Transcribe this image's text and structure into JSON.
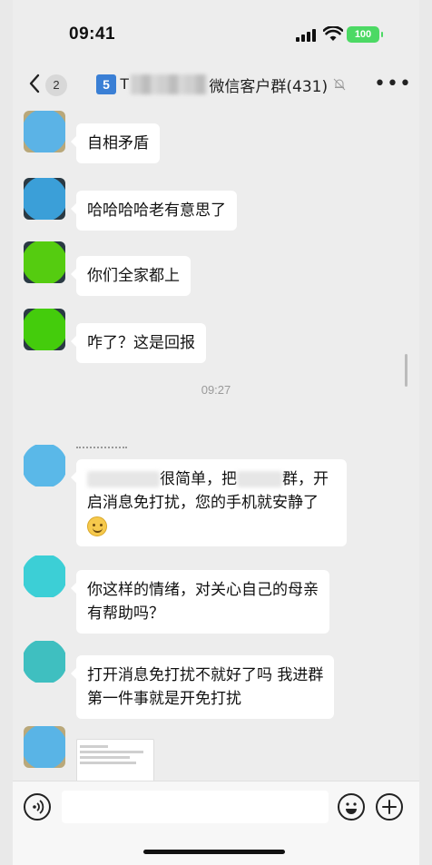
{
  "status_bar": {
    "time": "09:41",
    "battery": "100"
  },
  "nav": {
    "back_count": "2",
    "title_prefix_number": "5",
    "title_prefix_text": "T",
    "title_suffix": "微信客户群(431)"
  },
  "messages": [
    {
      "text": "自相矛盾"
    },
    {
      "text": "哈哈哈哈老有意思了"
    },
    {
      "text": "你们全家都上"
    },
    {
      "text": "咋了？这是回报"
    }
  ],
  "timestamp": "09:27",
  "long_message": {
    "part1": "很简单，把",
    "part2": "群，开",
    "line2": "启消息免打扰，您的手机就安静了"
  },
  "message_6": {
    "line1": "你这样的情绪，对关心自己的母亲",
    "line2": "有帮助吗？"
  },
  "message_7": {
    "line1": "打开消息免打扰不就好了吗 我进群",
    "line2": "第一件事就是开免打扰"
  },
  "colors": {
    "avatar1": "#5bb3e6",
    "avatar2": "#3b9fd8",
    "avatar3": "#55cc10",
    "avatar4": "#44cc0c",
    "avatar5": "#5ab8e8",
    "avatar6": "#3ccfd6",
    "avatar7": "#3fbfc0",
    "avatar8": "#59b4e6",
    "battery": "#4cd964"
  },
  "icons": [
    "back-chevron-icon",
    "bell-mute-icon",
    "more-dots-icon",
    "voice-icon",
    "emoji-icon",
    "plus-icon",
    "smile-emoji-icon"
  ]
}
